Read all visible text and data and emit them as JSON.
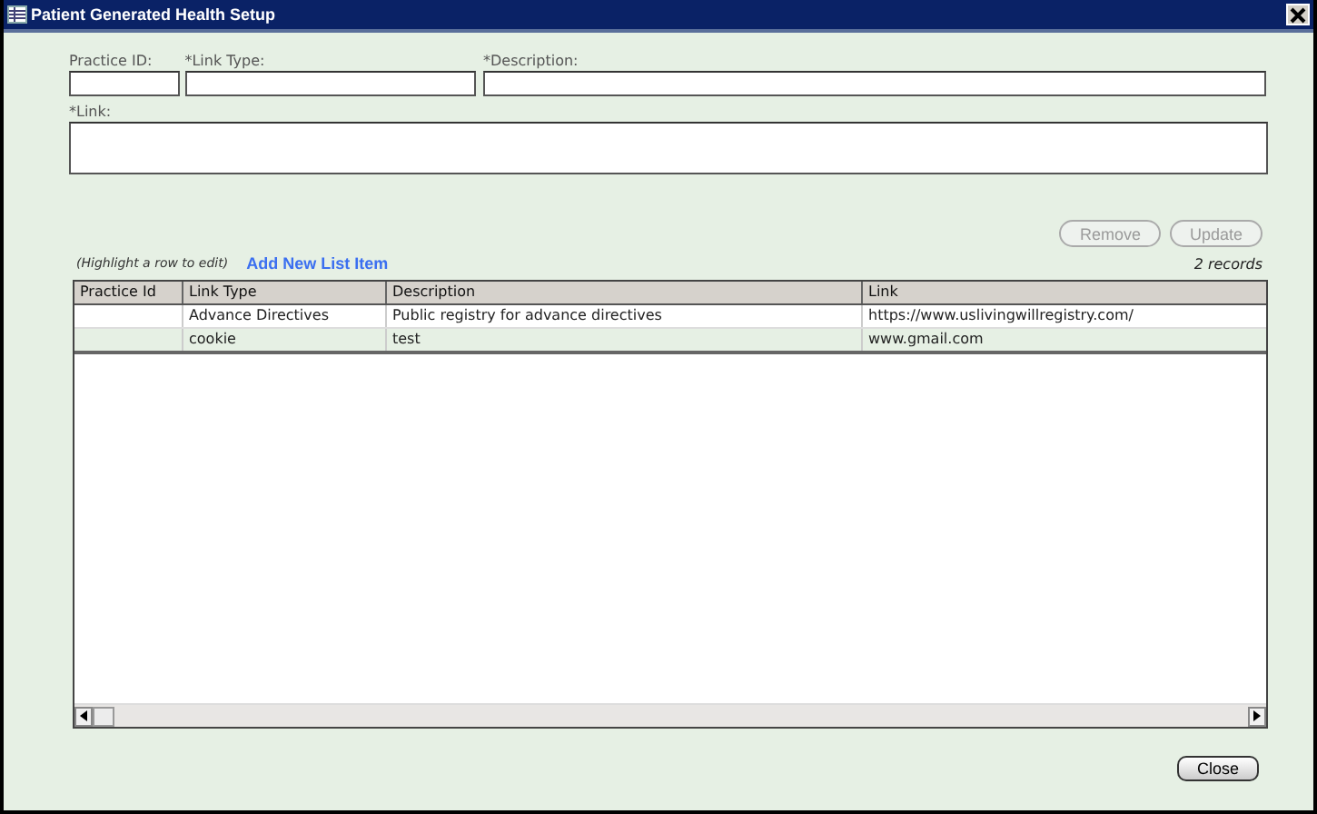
{
  "window": {
    "title": "Patient Generated Health Setup"
  },
  "form": {
    "practice_id": {
      "label": "Practice ID:"
    },
    "link_type": {
      "label": "*Link Type:"
    },
    "description": {
      "label": "*Description:"
    },
    "link": {
      "label": "*Link:"
    }
  },
  "actions": [
    {
      "label": "Remove",
      "disabled": true
    },
    {
      "label": "Update",
      "disabled": true
    }
  ],
  "hint": "(Highlight a row to edit)",
  "add_link": "Add New List Item",
  "record_count": "2 records",
  "table": {
    "columns": [
      "Practice Id",
      "Link Type",
      "Description",
      "Link"
    ],
    "rows": [
      [
        "",
        "Advance Directives",
        "Public registry for advance directives",
        "https://www.uslivingwillregistry.com/"
      ],
      [
        "",
        "cookie",
        "test",
        "www.gmail.com"
      ]
    ]
  },
  "close_button": "Close"
}
